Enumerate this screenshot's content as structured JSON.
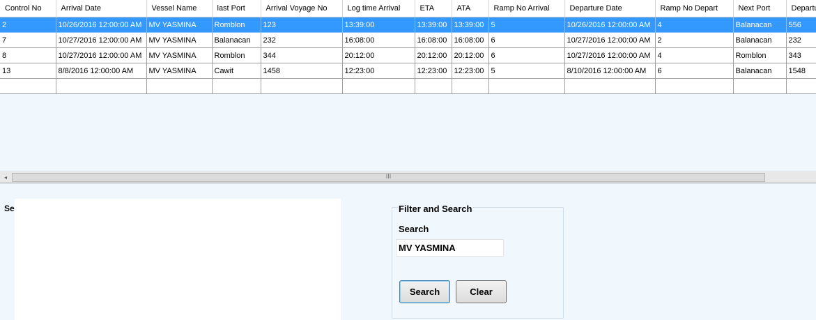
{
  "grid": {
    "columns": [
      "Control No",
      "Arrival Date",
      "Vessel Name",
      "last Port",
      "Arrival Voyage No",
      "Log time Arrival",
      "ETA",
      "ATA",
      "Ramp No Arrival",
      "Departure Date",
      "Ramp No Depart",
      "Next Port",
      "Departu"
    ],
    "rows": [
      [
        "2",
        "10/26/2016 12:00:00 AM",
        "MV YASMINA",
        "Romblon",
        "123",
        "13:39:00",
        "13:39:00",
        "13:39:00",
        "5",
        "10/26/2016 12:00:00 AM",
        "4",
        "Balanacan",
        "556"
      ],
      [
        "7",
        "10/27/2016 12:00:00 AM",
        "MV YASMINA",
        "Balanacan",
        "232",
        "16:08:00",
        "16:08:00",
        "16:08:00",
        "6",
        "10/27/2016 12:00:00 AM",
        "2",
        "Balanacan",
        "232"
      ],
      [
        "8",
        "10/27/2016 12:00:00 AM",
        "MV YASMINA",
        "Romblon",
        "344",
        "20:12:00",
        "20:12:00",
        "20:12:00",
        "6",
        "10/27/2016 12:00:00 AM",
        "4",
        "Romblon",
        "343"
      ],
      [
        "13",
        "8/8/2016 12:00:00 AM",
        "MV YASMINA",
        "Cawit",
        "1458",
        "12:23:00",
        "12:23:00",
        "12:23:00",
        "5",
        "8/10/2016 12:00:00 AM",
        "6",
        "Balanacan",
        "1548"
      ]
    ],
    "selected_row": 0
  },
  "scrollbar": {
    "left_arrow": "◂",
    "thumb_grip": "III"
  },
  "left_panel": {
    "label": "Se"
  },
  "filter": {
    "title": "Filter and Search",
    "search_label": "Search",
    "search_value": "MV YASMINA",
    "search_button": "Search",
    "clear_button": "Clear"
  }
}
